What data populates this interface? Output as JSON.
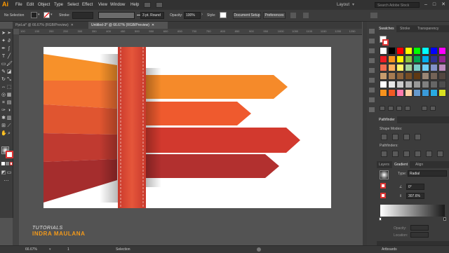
{
  "app": {
    "logo": "Ai",
    "accent": "#ff9a00"
  },
  "menu": {
    "items": [
      "File",
      "Edit",
      "Object",
      "Type",
      "Select",
      "Effect",
      "View",
      "Window",
      "Help"
    ]
  },
  "topright": {
    "workspace": "Layout",
    "search_placeholder": "Search Adobe Stock"
  },
  "control": {
    "selection": "No Selection",
    "stroke_label": "Stroke:",
    "stroke_style": "3 pt. Round",
    "opacity_label": "Opacity:",
    "opacity_value": "100%",
    "style_label": "Style:",
    "doc_setup": "Document Setup",
    "preferences": "Preferences"
  },
  "tabs": [
    {
      "label": "Ppd.ai* @ 66.67% (RGB/Preview)",
      "active": false
    },
    {
      "label": "Untitled-3* @ 66.67% (RGB/Preview)",
      "active": true
    }
  ],
  "ruler_ticks": [
    "100",
    "150",
    "200",
    "250",
    "300",
    "350",
    "400",
    "450",
    "500",
    "550",
    "600",
    "650",
    "700",
    "750",
    "800",
    "850",
    "900",
    "950",
    "1000",
    "1050",
    "1100",
    "1150",
    "1200",
    "1250"
  ],
  "artwork": {
    "arrows": [
      "#f58a2a",
      "#ef5a2e",
      "#d2392e",
      "#b2302f"
    ],
    "left_bands": [
      "#f7912a",
      "#f27032",
      "#e05530",
      "#c03a30",
      "#a52d2d"
    ],
    "ribbon": "#d8452f"
  },
  "panels": {
    "swatch_tabs": [
      "Swatches",
      "Stroke",
      "Transparency"
    ],
    "swatch_colors": [
      "#ffffff",
      "#000000",
      "#ff0000",
      "#ffff00",
      "#00ff00",
      "#00ffff",
      "#0000ff",
      "#ff00ff",
      "#ed1c24",
      "#f7941d",
      "#fff200",
      "#8dc63f",
      "#00a651",
      "#00aeef",
      "#2e3192",
      "#92278f",
      "#f26c4f",
      "#fbaf5d",
      "#fff568",
      "#a3d39c",
      "#7accc8",
      "#6dcff6",
      "#8393ca",
      "#bd8cbf",
      "#c69c6d",
      "#a67c52",
      "#8c6239",
      "#754c24",
      "#603913",
      "#998675",
      "#736357",
      "#534741",
      "#ffffff",
      "#e6e6e6",
      "#cccccc",
      "#b3b3b3",
      "#999999",
      "#808080",
      "#666666",
      "#4d4d4d",
      "#f7931e",
      "#f15a24",
      "#ff7bac",
      "#ffd0a0",
      "#6699cc",
      "#3a9ad9",
      "#29abe2",
      "#d9e021"
    ],
    "pathfinder": {
      "title": "Pathfinder",
      "shape_modes": "Shape Modes:",
      "pathfinders": "Pathfinders:"
    },
    "gradient_tabs": [
      "Layers",
      "Gradient",
      "Align"
    ],
    "gradient": {
      "type_label": "Type:",
      "type_value": "Radial",
      "angle": "0°",
      "ratio": "307.6%",
      "opacity_label": "Opacity:",
      "location_label": "Location:"
    },
    "artboards": "Artboards"
  },
  "status": {
    "zoom": "66.67%",
    "page": "1",
    "tool": "Selection"
  },
  "watermark": {
    "line1": "TUTORIALS",
    "line2": "INDRA MAULANA"
  }
}
